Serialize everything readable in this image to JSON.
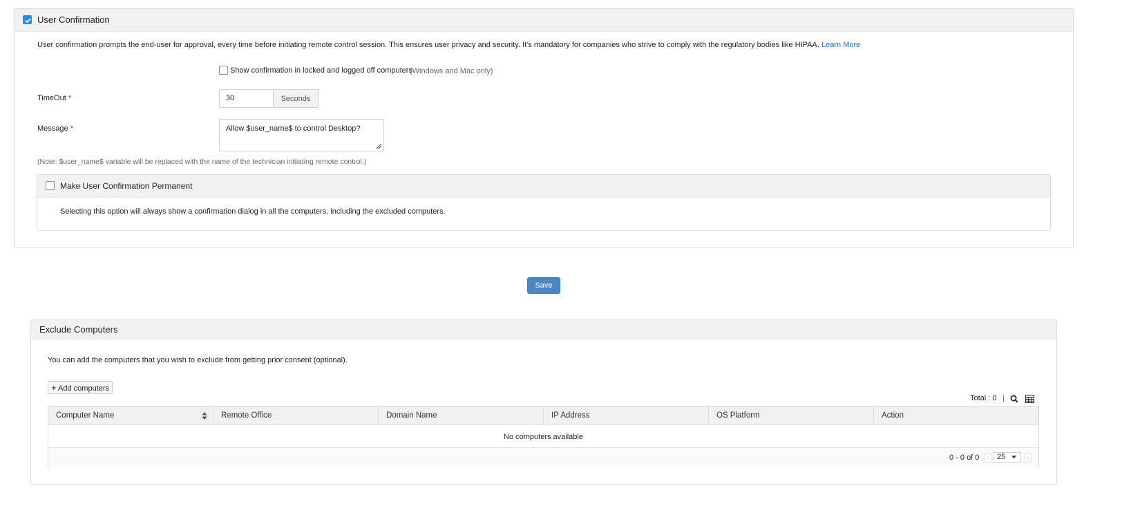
{
  "user_confirmation": {
    "title": "User Confirmation",
    "checked": true,
    "description": "User confirmation prompts the end-user for approval, every time before initiating remote control session. This ensures user privacy and security. It's mandatory for companies who strive to comply with the regulatory bodies like HIPAA.",
    "learn_more": "Learn More",
    "locked_option_label": "Show confirmation in locked and logged off computers",
    "locked_option_note": "(Windows and Mac only)",
    "timeout_label": "TimeOut",
    "required_mark": "*",
    "timeout_value": "30",
    "timeout_unit": "Seconds",
    "message_label": "Message",
    "message_value": "Allow $user_name$ to control Desktop?",
    "note": "(Note: $user_name$ variable will be replaced with the name of the technician initiating remote control.)",
    "permanent": {
      "title": "Make User Confirmation Permanent",
      "description": "Selecting this option will always show a confirmation dialog in all the computers, including the excluded computers."
    }
  },
  "save_label": "Save",
  "exclude": {
    "title": "Exclude Computers",
    "description": "You can add the computers that you wish to exclude from getting prior consent (optional).",
    "add_button": "Add computers",
    "add_icon_text": "+",
    "total_label": "Total : 0",
    "separator": "|",
    "columns": [
      "Computer Name",
      "Remote Office",
      "Domain Name",
      "IP Address",
      "OS Platform",
      "Action"
    ],
    "empty_text": "No computers available",
    "pager_range": "0 - 0 of 0",
    "page_size": "25",
    "prev_icon": "‹",
    "next_icon": "›"
  },
  "colors": {
    "accent": "#2a8fd8",
    "save_button": "#4a87c4",
    "link": "#1f6fb5",
    "header_bg": "#f1f1f1"
  }
}
